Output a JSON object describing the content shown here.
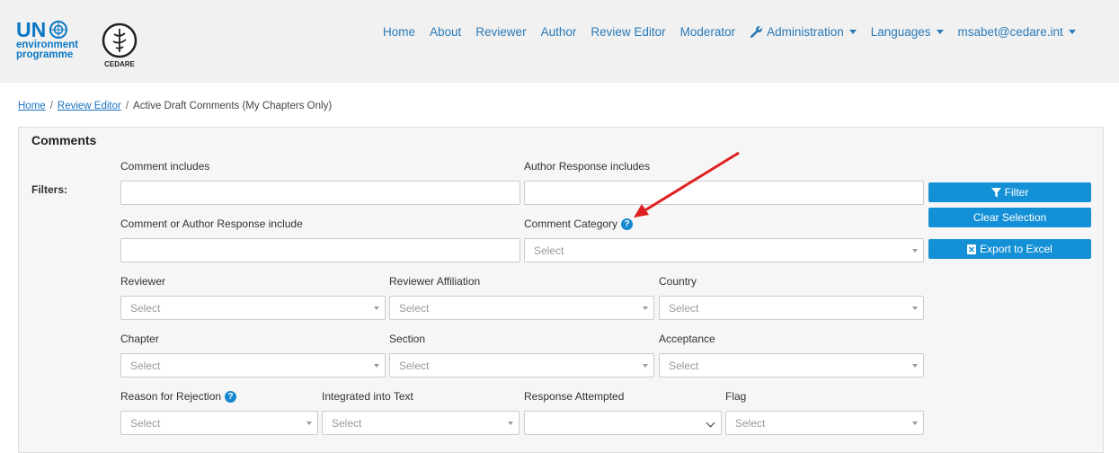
{
  "brand": {
    "un_text": "UN",
    "un_sub_line1": "environment",
    "un_sub_line2": "programme",
    "cedare_text": "CEDARE"
  },
  "nav": {
    "items": [
      {
        "label": "Home"
      },
      {
        "label": "About"
      },
      {
        "label": "Reviewer"
      },
      {
        "label": "Author"
      },
      {
        "label": "Review Editor"
      },
      {
        "label": "Moderator"
      },
      {
        "label": "Administration"
      },
      {
        "label": "Languages"
      },
      {
        "label": "msabet@cedare.int"
      }
    ]
  },
  "breadcrumb": {
    "home": "Home",
    "review_editor": "Review Editor",
    "current": "Active Draft Comments (My Chapters Only)",
    "separator": "/"
  },
  "panel": {
    "title": "Comments",
    "filters_label": "Filters:"
  },
  "fields": {
    "comment_includes": {
      "label": "Comment includes",
      "value": ""
    },
    "author_response_includes": {
      "label": "Author Response includes",
      "value": ""
    },
    "comment_or_author": {
      "label": "Comment or Author Response include",
      "value": ""
    },
    "comment_category": {
      "label": "Comment Category",
      "value": "Select"
    },
    "reviewer": {
      "label": "Reviewer",
      "value": "Select"
    },
    "reviewer_affiliation": {
      "label": "Reviewer Affiliation",
      "value": "Select"
    },
    "country": {
      "label": "Country",
      "value": "Select"
    },
    "chapter": {
      "label": "Chapter",
      "value": "Select"
    },
    "section": {
      "label": "Section",
      "value": "Select"
    },
    "acceptance": {
      "label": "Acceptance",
      "value": "Select"
    },
    "reason_for_rejection": {
      "label": "Reason for Rejection",
      "value": "Select"
    },
    "integrated_into_text": {
      "label": "Integrated into Text",
      "value": "Select"
    },
    "response_attempted": {
      "label": "Response Attempted",
      "value": ""
    },
    "flag": {
      "label": "Flag",
      "value": "Select"
    }
  },
  "buttons": {
    "filter": "Filter",
    "clear_selection": "Clear Selection",
    "export": "Export to Excel"
  },
  "colors": {
    "brand_blue": "#0a77c5",
    "nav_link": "#2a7ab8",
    "button": "#1490d6",
    "annotation_arrow": "#e02020"
  }
}
